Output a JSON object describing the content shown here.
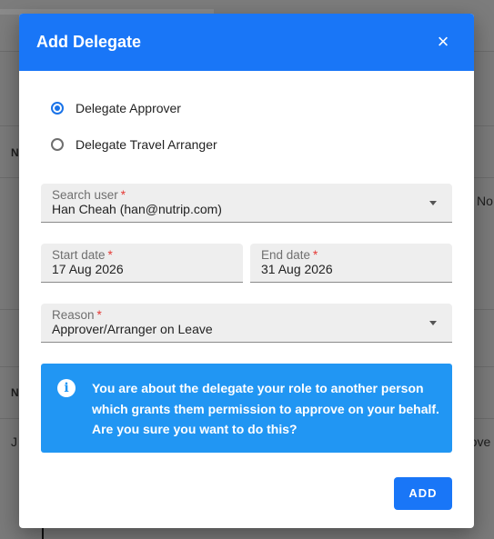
{
  "background": {
    "col_header_1": "N",
    "col_header_2": "N",
    "cell_right_1": "No",
    "cell_left_2": "J",
    "cell_right_2": "rove"
  },
  "dialog": {
    "title": "Add Delegate",
    "close_icon": "×",
    "options": [
      {
        "label": "Delegate Approver",
        "selected": true
      },
      {
        "label": "Delegate Travel Arranger",
        "selected": false
      }
    ],
    "search_user": {
      "label": "Search user",
      "required_mark": "*",
      "value": "Han Cheah (han@nutrip.com)"
    },
    "start_date": {
      "label": "Start date",
      "required_mark": "*",
      "value": "17 Aug 2026"
    },
    "end_date": {
      "label": "End date",
      "required_mark": "*",
      "value": "31 Aug 2026"
    },
    "reason": {
      "label": "Reason",
      "required_mark": "*",
      "value": "Approver/Arranger on Leave"
    },
    "info": {
      "icon": "i",
      "text": "You are about the delegate your role to another person which grants them permission to approve on your behalf. Are you sure you want to do this?"
    },
    "add_label": "ADD"
  },
  "colors": {
    "primary": "#1976f7",
    "info": "#2196f3",
    "required": "#e53935"
  }
}
